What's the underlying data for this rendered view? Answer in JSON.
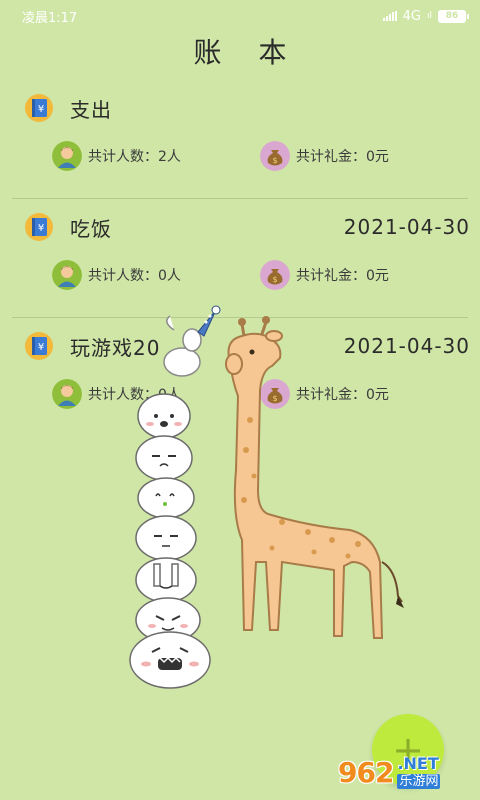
{
  "status_bar": {
    "time": "凌晨1:17",
    "network": "4G",
    "network_sub": "ıl",
    "battery": "86"
  },
  "header": {
    "title": "账 本"
  },
  "entries": [
    {
      "title": "支出",
      "date": "",
      "people_label": "共计人数：2人",
      "money_label": "共计礼金：0元"
    },
    {
      "title": "吃饭",
      "date": "2021-04-30",
      "people_label": "共计人数：0人",
      "money_label": "共计礼金：0元"
    },
    {
      "title": "玩游戏20",
      "date": "2021-04-30",
      "people_label": "共计人数：0人",
      "money_label": "共计礼金：0元"
    }
  ],
  "fab": {
    "label": "+"
  },
  "watermark": {
    "number": "962",
    "suffix": ".NET",
    "site": "乐游网"
  },
  "icons": {
    "ledger": "ledger-book-icon",
    "people": "person-avatar-icon",
    "money": "money-bag-icon"
  },
  "colors": {
    "background": "#cfe6a6",
    "fab": "#bdea3c",
    "ledger_icon": "#3a7bd5",
    "ledger_ring": "#f3b93b",
    "people_icon_bg": "#8fbf3a",
    "money_icon_bg": "#d9a7d0"
  }
}
